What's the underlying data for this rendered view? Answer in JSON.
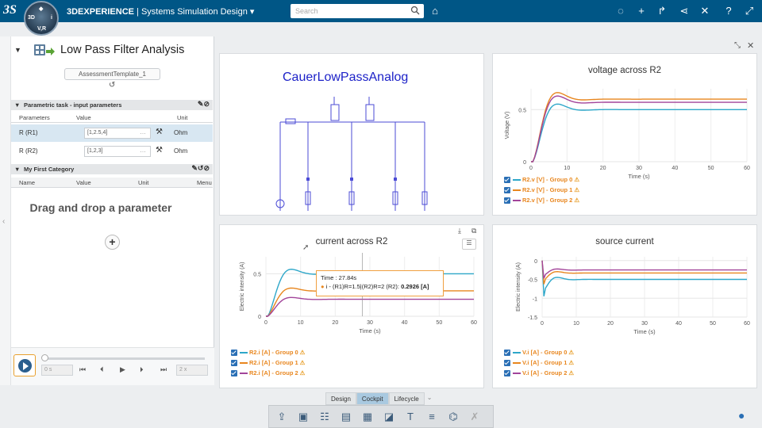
{
  "app": {
    "brand": "3DEXPERIENCE",
    "separator": "|",
    "app_name": "Systems Simulation Design",
    "search_placeholder": "Search"
  },
  "compass": {
    "left": "3D",
    "right": "i",
    "bottom": "V,R",
    "top": "◆"
  },
  "panel": {
    "title": "Low Pass Filter Analysis",
    "template": "AssessmentTemplate_1",
    "section1": "Parametric task - input parameters",
    "cols1": [
      "Parameters",
      "Value",
      "Unit"
    ],
    "params": [
      {
        "name": "R (R1)",
        "value": "[1,2.5,4]",
        "unit": "Ohm"
      },
      {
        "name": "R (R2)",
        "value": "[1,2,3]",
        "unit": "Ohm"
      }
    ],
    "section2": "My First Category",
    "cols2": [
      "Name",
      "Value",
      "Unit",
      "Menu"
    ],
    "drag_text": "Drag and drop a parameter",
    "add": "+"
  },
  "player": {
    "time": "0 s",
    "speed": "2 x"
  },
  "diagram": {
    "title": "CauerLowPassAnalog"
  },
  "charts": [
    {
      "title": "voltage across R2",
      "ylabel": "Voltage (V)",
      "xlabel": "Time (s)",
      "xticks": [
        "0",
        "10",
        "20",
        "30",
        "40",
        "50",
        "60"
      ],
      "yticks": [
        "0",
        "0.5"
      ],
      "series": [
        {
          "name": "R2.v [V] - Group 0",
          "color": "#2ea7c9",
          "final": 0.5
        },
        {
          "name": "R2.v [V] - Group 1",
          "color": "#e8861e",
          "final": 0.6
        },
        {
          "name": "R2.v [V] - Group 2",
          "color": "#a2449a",
          "final": 0.57
        }
      ]
    },
    {
      "title": "current across R2",
      "ylabel": "Electric intensity (A)",
      "xlabel": "Time (s)",
      "xticks": [
        "0",
        "10",
        "20",
        "30",
        "40",
        "50",
        "60"
      ],
      "yticks": [
        "0",
        "0.5"
      ],
      "series": [
        {
          "name": "R2.i [A] - Group 0",
          "color": "#2ea7c9",
          "final": 0.5
        },
        {
          "name": "R2.i [A] - Group 1",
          "color": "#e8861e",
          "final": 0.3
        },
        {
          "name": "R2.i [A] - Group 2",
          "color": "#a2449a",
          "final": 0.2
        }
      ],
      "tooltip": {
        "time": "Time : 27.84s",
        "text": "i - (R1)R=1.5|(R2)R=2 (R2):",
        "value": "0.2926 [A]"
      }
    },
    {
      "title": "source current",
      "ylabel": "Electric intensity (A)",
      "xlabel": "Time (s)",
      "xticks": [
        "0",
        "10",
        "20",
        "30",
        "40",
        "50",
        "60"
      ],
      "yticks": [
        "0",
        "-0.5",
        "-1",
        "-1.5"
      ],
      "series": [
        {
          "name": "V.i [A] - Group 0",
          "color": "#2ea7c9",
          "final": -0.5
        },
        {
          "name": "V.i [A] - Group 1",
          "color": "#e8861e",
          "final": -0.33
        },
        {
          "name": "V.i [A] - Group 2",
          "color": "#a2449a",
          "final": -0.25
        }
      ]
    }
  ],
  "tabs": [
    "Design",
    "Cockpit",
    "Lifecycle"
  ],
  "active_tab": "Cockpit"
}
